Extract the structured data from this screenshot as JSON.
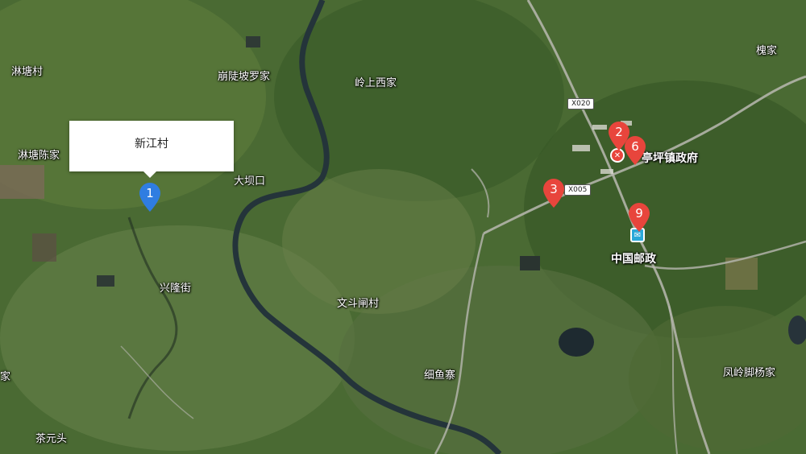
{
  "map": {
    "popup_title": "新江村",
    "labels": {
      "l1": "淋塘村",
      "l2": "崩陡坡罗家",
      "l3": "岭上西家",
      "l4": "淋塘陈家",
      "l5": "大坝口",
      "l6": "亭坪镇政府",
      "l7": "中国邮政",
      "l8": "兴隆街",
      "l9": "文斗闸村",
      "l10": "细鱼寨",
      "l11": "凤岭脚杨家",
      "l12": "茶元头",
      "l13": "槐家",
      "l14": "家"
    },
    "roads": {
      "r1": "X020",
      "r2": "X005"
    },
    "pins": {
      "p1": "1",
      "p2": "2",
      "p3": "3",
      "p6": "6",
      "p9": "9"
    },
    "poi_icons": {
      "gov": "government-icon",
      "post": "post-office-icon"
    },
    "colors": {
      "pin_red": "#e8453c",
      "pin_blue": "#2f7de1",
      "road": "#b8b8b0",
      "river": "#2a3a40"
    }
  }
}
